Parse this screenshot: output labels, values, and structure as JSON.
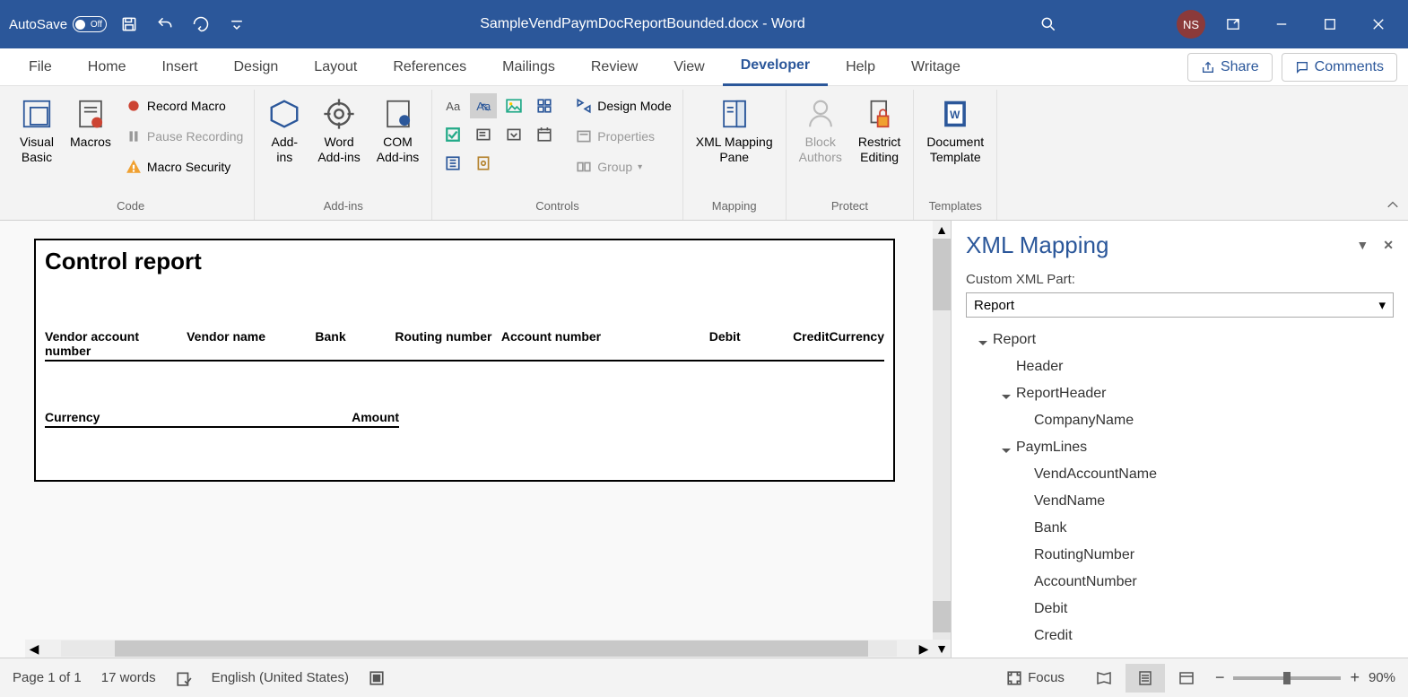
{
  "titlebar": {
    "autosave": "AutoSave",
    "autosave_state": "Off",
    "filename": "SampleVendPaymDocReportBounded.docx - Word",
    "user_initials": "NS"
  },
  "tabs": {
    "file": "File",
    "home": "Home",
    "insert": "Insert",
    "design": "Design",
    "layout": "Layout",
    "references": "References",
    "mailings": "Mailings",
    "review": "Review",
    "view": "View",
    "developer": "Developer",
    "help": "Help",
    "writage": "Writage"
  },
  "actions": {
    "share": "Share",
    "comments": "Comments"
  },
  "ribbon": {
    "code": {
      "label": "Code",
      "visual_basic": "Visual\nBasic",
      "macros": "Macros",
      "record": "Record Macro",
      "pause": "Pause Recording",
      "security": "Macro Security"
    },
    "addins": {
      "label": "Add-ins",
      "addins": "Add-\nins",
      "word": "Word\nAdd-ins",
      "com": "COM\nAdd-ins"
    },
    "controls": {
      "label": "Controls",
      "design_mode": "Design Mode",
      "properties": "Properties",
      "group": "Group"
    },
    "mapping": {
      "label": "Mapping",
      "pane": "XML Mapping\nPane"
    },
    "protect": {
      "label": "Protect",
      "block": "Block\nAuthors",
      "restrict": "Restrict\nEditing"
    },
    "templates": {
      "label": "Templates",
      "template": "Document\nTemplate"
    }
  },
  "document": {
    "title": "Control report",
    "headers": {
      "vendor_acct": "Vendor account number",
      "vendor_name": "Vendor name",
      "bank": "Bank",
      "routing": "Routing number",
      "account": "Account number",
      "debit": "Debit",
      "credit": "Credit",
      "currency": "Currency",
      "currency2": "Currency",
      "amount": "Amount"
    }
  },
  "xml_pane": {
    "title": "XML Mapping",
    "label": "Custom XML Part:",
    "selected": "Report",
    "tree": {
      "report": "Report",
      "header": "Header",
      "report_header": "ReportHeader",
      "company_name": "CompanyName",
      "paym_lines": "PaymLines",
      "vend_account": "VendAccountName",
      "vend_name": "VendName",
      "bank": "Bank",
      "routing": "RoutingNumber",
      "account": "AccountNumber",
      "debit": "Debit",
      "credit": "Credit"
    }
  },
  "statusbar": {
    "page": "Page 1 of 1",
    "words": "17 words",
    "language": "English (United States)",
    "focus": "Focus",
    "zoom": "90%"
  }
}
